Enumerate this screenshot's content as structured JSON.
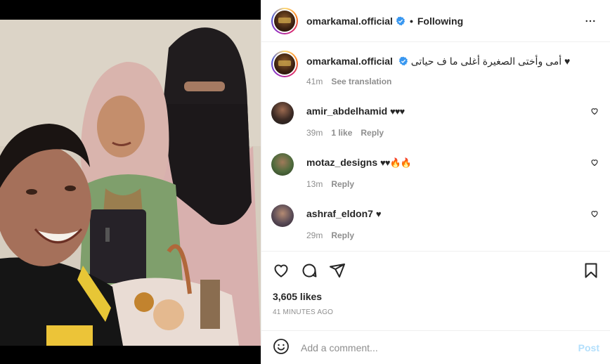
{
  "post": {
    "author": "omarkamal.official",
    "separator": "•",
    "follow_state": "Following",
    "caption": "أمى وأختى الصغيرة أغلى ما ف حياتى",
    "caption_heart": "♥",
    "caption_time": "41m",
    "see_translation": "See translation"
  },
  "comments": [
    {
      "user": "amir_abdelhamid",
      "text": "♥♥♥",
      "time": "39m",
      "likes": "1 like",
      "reply": "Reply"
    },
    {
      "user": "motaz_designs",
      "text": "♥♥🔥🔥",
      "time": "13m",
      "reply": "Reply"
    },
    {
      "user": "ashraf_eldon7",
      "text": "♥",
      "time": "29m",
      "reply": "Reply"
    }
  ],
  "stats": {
    "likes": "3,605 likes",
    "posted": "41 MINUTES AGO"
  },
  "add_comment": {
    "placeholder": "Add a comment...",
    "post_label": "Post"
  },
  "icons": [
    "verified-badge-icon",
    "more-options-icon",
    "heart-icon",
    "comment-icon",
    "share-icon",
    "save-icon",
    "emoji-icon"
  ],
  "colors": {
    "verified": "#3897f0",
    "muted": "#8e8e8e",
    "post_disabled": "#b2dffc",
    "text": "#262626"
  }
}
